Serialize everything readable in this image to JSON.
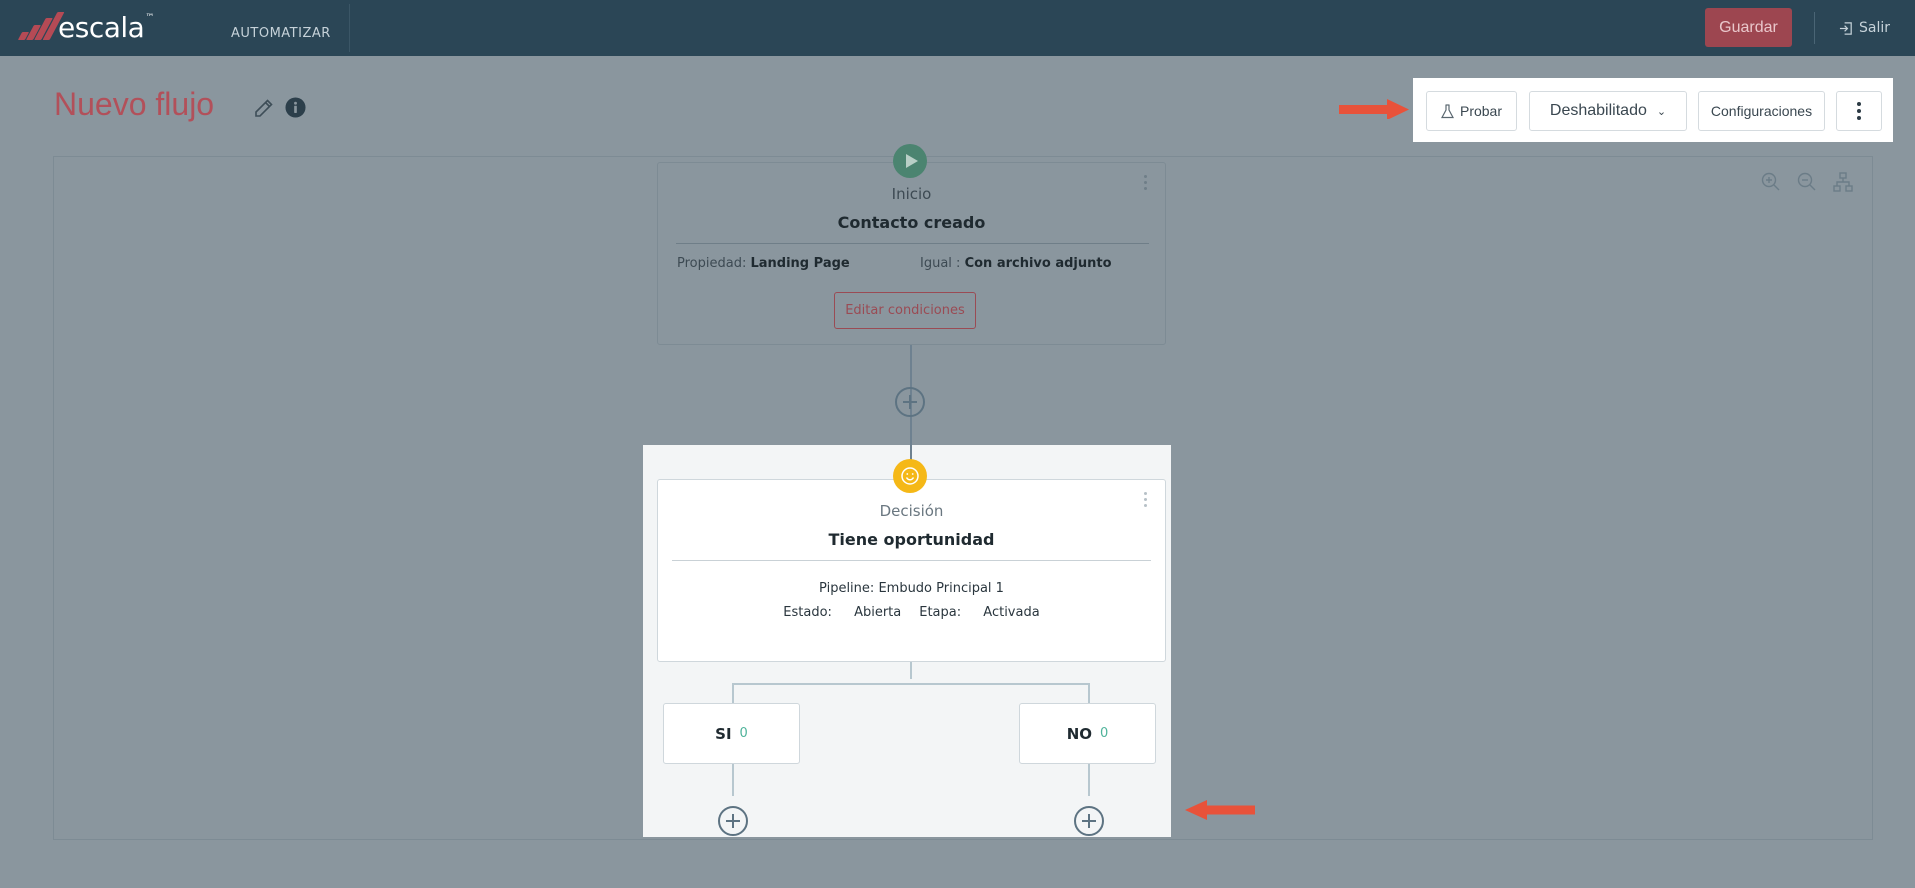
{
  "app": {
    "logo_text": "escala",
    "logo_tm": "™",
    "nav_item": "AUTOMATIZAR",
    "save_label": "Guardar",
    "logout_label": "Salir"
  },
  "page": {
    "title": "Nuevo flujo"
  },
  "toolbar": {
    "test_label": "Probar",
    "status_value": "Deshabilitado",
    "settings_label": "Configuraciones"
  },
  "flow": {
    "start_node": {
      "type": "Inicio",
      "title": "Contacto creado",
      "property_label": "Propiedad:",
      "property_value": "Landing Page",
      "operator_label": "Igual :",
      "operator_value": "Con archivo adjunto",
      "edit_button": "Editar condiciones"
    },
    "decision_node": {
      "type": "Decisión",
      "title": "Tiene oportunidad",
      "pipeline_label": "Pipeline:",
      "pipeline_value": "Embudo Principal 1",
      "state_label": "Estado:",
      "state_value": "Abierta",
      "stage_label": "Etapa:",
      "stage_value": "Activada"
    },
    "branches": [
      {
        "label": "SI",
        "count": "0"
      },
      {
        "label": "NO",
        "count": "0"
      }
    ]
  },
  "colors": {
    "topbar": "#2b4656",
    "brand_red": "#b2505a",
    "annotation_arrow": "#e8523a",
    "decision_icon": "#f5b817",
    "start_icon": "#4b8470"
  },
  "icons": [
    "logo-icon",
    "logout-icon",
    "edit-icon",
    "info-icon",
    "flask-icon",
    "chevron-down-icon",
    "more-vertical-icon",
    "zoom-in-icon",
    "zoom-out-icon",
    "layout-icon",
    "play-icon",
    "smile-icon",
    "plus-circle-icon"
  ]
}
